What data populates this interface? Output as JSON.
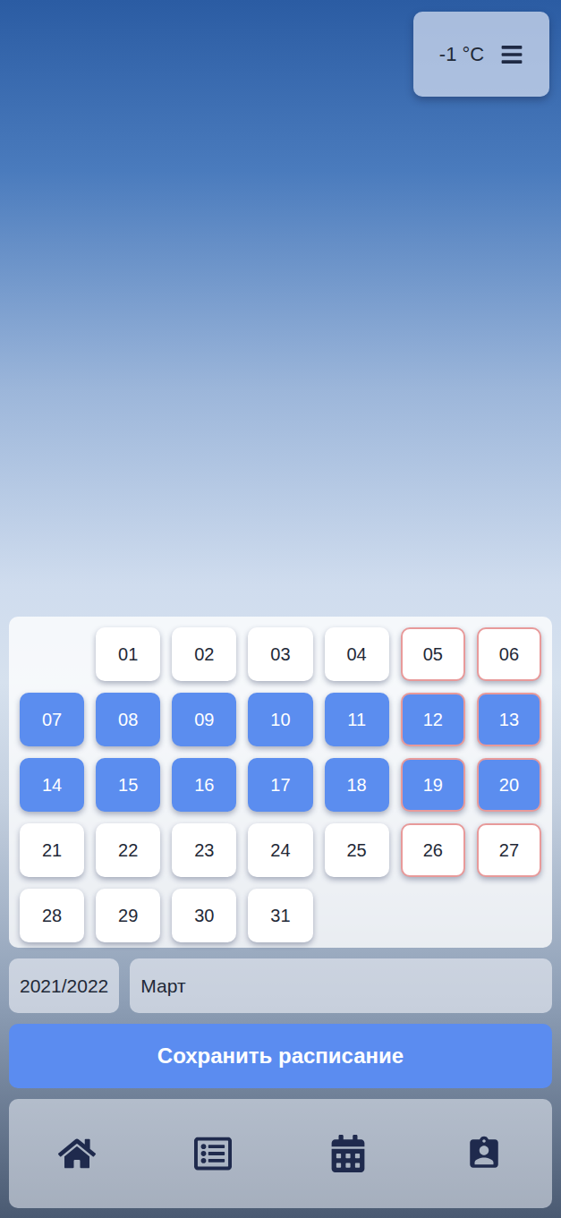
{
  "weather": {
    "temperature": "-1 °C",
    "menu_button": true
  },
  "calendar": {
    "empty_before": 1,
    "days": [
      {
        "day": "01",
        "selected": false,
        "weekend": false
      },
      {
        "day": "02",
        "selected": false,
        "weekend": false
      },
      {
        "day": "03",
        "selected": false,
        "weekend": false
      },
      {
        "day": "04",
        "selected": false,
        "weekend": false
      },
      {
        "day": "05",
        "selected": false,
        "weekend": true
      },
      {
        "day": "06",
        "selected": false,
        "weekend": true
      },
      {
        "day": "07",
        "selected": true,
        "weekend": false
      },
      {
        "day": "08",
        "selected": true,
        "weekend": false
      },
      {
        "day": "09",
        "selected": true,
        "weekend": false
      },
      {
        "day": "10",
        "selected": true,
        "weekend": false
      },
      {
        "day": "11",
        "selected": true,
        "weekend": false
      },
      {
        "day": "12",
        "selected": true,
        "weekend": true
      },
      {
        "day": "13",
        "selected": true,
        "weekend": true
      },
      {
        "day": "14",
        "selected": true,
        "weekend": false
      },
      {
        "day": "15",
        "selected": true,
        "weekend": false
      },
      {
        "day": "16",
        "selected": true,
        "weekend": false
      },
      {
        "day": "17",
        "selected": true,
        "weekend": false
      },
      {
        "day": "18",
        "selected": true,
        "weekend": false
      },
      {
        "day": "19",
        "selected": true,
        "weekend": true
      },
      {
        "day": "20",
        "selected": true,
        "weekend": true
      },
      {
        "day": "21",
        "selected": false,
        "weekend": false
      },
      {
        "day": "22",
        "selected": false,
        "weekend": false
      },
      {
        "day": "23",
        "selected": false,
        "weekend": false
      },
      {
        "day": "24",
        "selected": false,
        "weekend": false
      },
      {
        "day": "25",
        "selected": false,
        "weekend": false
      },
      {
        "day": "26",
        "selected": false,
        "weekend": true
      },
      {
        "day": "27",
        "selected": false,
        "weekend": true
      },
      {
        "day": "28",
        "selected": false,
        "weekend": false
      },
      {
        "day": "29",
        "selected": false,
        "weekend": false
      },
      {
        "day": "30",
        "selected": false,
        "weekend": false
      },
      {
        "day": "31",
        "selected": false,
        "weekend": false
      }
    ]
  },
  "year_select": {
    "value": "2021/2022"
  },
  "month_select": {
    "value": "Март"
  },
  "save_button": {
    "label": "Сохранить расписание"
  }
}
